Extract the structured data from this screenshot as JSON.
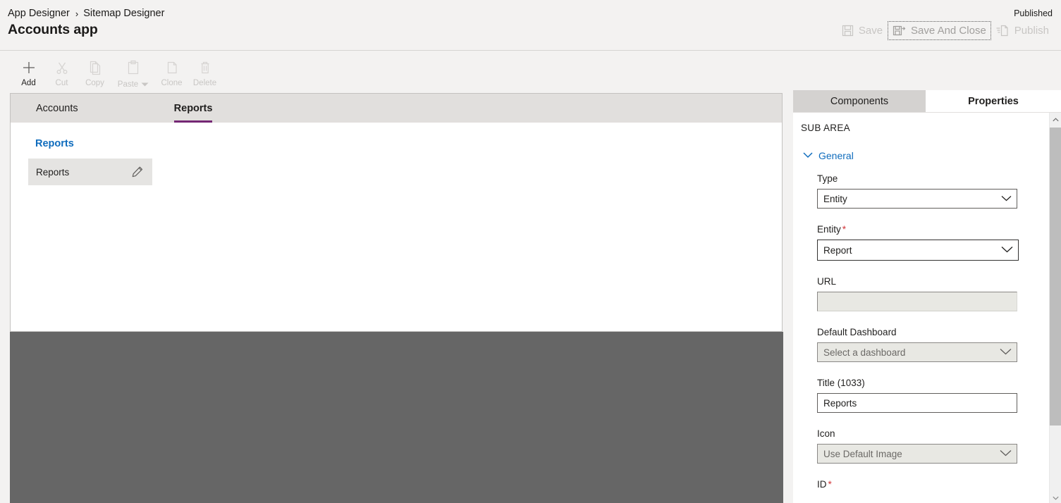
{
  "header": {
    "breadcrumb": [
      {
        "label": "App Designer"
      },
      {
        "label": "Sitemap Designer"
      }
    ],
    "breadcrumb_separator": "›",
    "app_title": "Accounts app",
    "publish_status": "Published",
    "actions": [
      {
        "id": "save",
        "label": "Save",
        "icon": "save-icon",
        "disabled": true,
        "focused": false
      },
      {
        "id": "save-and-close",
        "label": "Save And Close",
        "icon": "save-and-close-icon",
        "disabled": true,
        "focused": true
      },
      {
        "id": "publish",
        "label": "Publish",
        "icon": "publish-icon",
        "disabled": true,
        "focused": false
      }
    ]
  },
  "toolbar": {
    "items": [
      {
        "id": "add",
        "label": "Add",
        "icon": "plus-icon",
        "enabled": true,
        "has_caret": false
      },
      {
        "id": "cut",
        "label": "Cut",
        "icon": "scissors-icon",
        "enabled": false,
        "has_caret": false
      },
      {
        "id": "copy",
        "label": "Copy",
        "icon": "copy-icon",
        "enabled": false,
        "has_caret": false
      },
      {
        "id": "paste",
        "label": "Paste",
        "icon": "clipboard-icon",
        "enabled": false,
        "has_caret": true
      },
      {
        "id": "clone",
        "label": "Clone",
        "icon": "clone-icon",
        "enabled": false,
        "has_caret": false
      },
      {
        "id": "delete",
        "label": "Delete",
        "icon": "trash-icon",
        "enabled": false,
        "has_caret": false
      }
    ]
  },
  "canvas": {
    "tabs": [
      {
        "id": "accounts",
        "label": "Accounts",
        "active": false
      },
      {
        "id": "reports",
        "label": "Reports",
        "active": true
      }
    ],
    "active_tab_underline_color": "#742774",
    "group": {
      "title": "Reports",
      "title_color": "#0f6cbd",
      "sub_areas": [
        {
          "label": "Reports",
          "edit_icon": "pencil-icon"
        }
      ]
    }
  },
  "right_panel": {
    "tabs": [
      {
        "id": "components",
        "label": "Components",
        "active": false
      },
      {
        "id": "properties",
        "label": "Properties",
        "active": true
      }
    ],
    "section_header": "SUB AREA",
    "group": {
      "label": "General",
      "expanded": true,
      "chevron_icon": "chevron-down-icon"
    },
    "fields": [
      {
        "id": "type",
        "label": "Type",
        "required": false,
        "control": "select",
        "value": "Entity",
        "placeholder": "",
        "disabled": false,
        "focused": false
      },
      {
        "id": "entity",
        "label": "Entity",
        "required": true,
        "control": "select",
        "value": "Report",
        "placeholder": "",
        "disabled": false,
        "focused": true
      },
      {
        "id": "url",
        "label": "URL",
        "required": false,
        "control": "text",
        "value": "",
        "placeholder": "",
        "disabled": true,
        "focused": false
      },
      {
        "id": "default-dashboard",
        "label": "Default Dashboard",
        "required": false,
        "control": "select",
        "value": "",
        "placeholder": "Select a dashboard",
        "disabled": true,
        "focused": false
      },
      {
        "id": "title-1033",
        "label": "Title (1033)",
        "required": false,
        "control": "text",
        "value": "Reports",
        "placeholder": "",
        "disabled": false,
        "focused": false
      },
      {
        "id": "icon",
        "label": "Icon",
        "required": false,
        "control": "select",
        "value": "",
        "placeholder": "Use Default Image",
        "disabled": true,
        "focused": false
      },
      {
        "id": "id",
        "label": "ID",
        "required": true,
        "control": "text",
        "value": "",
        "placeholder": "",
        "disabled": false,
        "focused": false,
        "clipped": true
      }
    ],
    "scrollbar": {
      "up_icon": "chevron-up-icon",
      "down_icon": "chevron-down-icon"
    }
  }
}
